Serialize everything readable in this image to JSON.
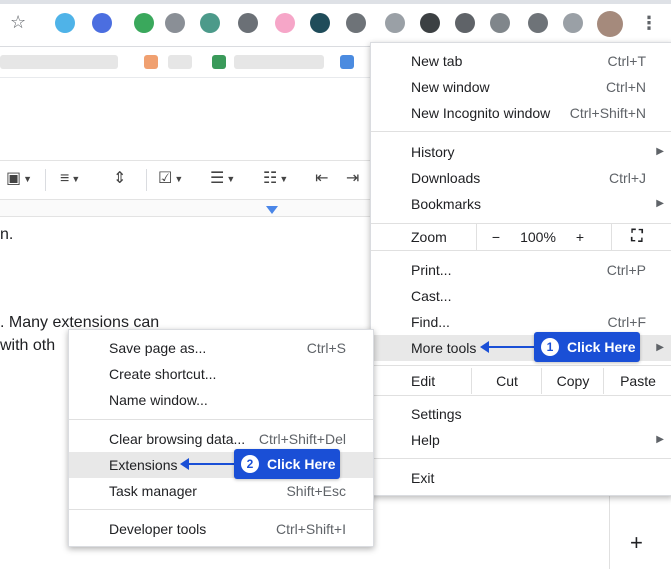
{
  "browser": {
    "star_icon": "star-icon",
    "more_icon": "vertical-dots-icon",
    "extension_colors": [
      "#4fb3e8",
      "#4b6ee0",
      "#3aa85c",
      "#8a8f96",
      "#4c9a8a",
      "#6b7076",
      "#f6a6c8",
      "#1f4c5a",
      "#6e7378",
      "#9aa0a6",
      "#3c4043",
      "#5f6368",
      "#80868b"
    ]
  },
  "doc": {
    "line1": "n.",
    "line2": ". Many extensions can",
    "line3": " with oth",
    "toolbar_icons": [
      "image-icon",
      "align-icon",
      "line-spacing-icon",
      "checklist-icon",
      "bullet-list-icon",
      "numbered-list-icon",
      "decrease-indent-icon",
      "increase-indent-icon"
    ],
    "plus_label": "+"
  },
  "menu": {
    "new_tab": {
      "label": "New tab",
      "shortcut": "Ctrl+T"
    },
    "new_window": {
      "label": "New window",
      "shortcut": "Ctrl+N"
    },
    "new_incognito": {
      "label": "New Incognito window",
      "shortcut": "Ctrl+Shift+N"
    },
    "history": {
      "label": "History"
    },
    "downloads": {
      "label": "Downloads",
      "shortcut": "Ctrl+J"
    },
    "bookmarks": {
      "label": "Bookmarks"
    },
    "zoom": {
      "label": "Zoom",
      "minus": "−",
      "value": "100%",
      "plus": "+"
    },
    "print": {
      "label": "Print...",
      "shortcut": "Ctrl+P"
    },
    "cast": {
      "label": "Cast..."
    },
    "find": {
      "label": "Find...",
      "shortcut": "Ctrl+F"
    },
    "more_tools": {
      "label": "More tools"
    },
    "edit": {
      "label": "Edit",
      "cut": "Cut",
      "copy": "Copy",
      "paste": "Paste"
    },
    "settings": {
      "label": "Settings"
    },
    "help": {
      "label": "Help"
    },
    "exit": {
      "label": "Exit"
    }
  },
  "submenu": {
    "save_page": {
      "label": "Save page as...",
      "shortcut": "Ctrl+S"
    },
    "create_shortcut": {
      "label": "Create shortcut..."
    },
    "name_window": {
      "label": "Name window..."
    },
    "clear_data": {
      "label": "Clear browsing data...",
      "shortcut": "Ctrl+Shift+Del"
    },
    "extensions": {
      "label": "Extensions"
    },
    "task_manager": {
      "label": "Task manager",
      "shortcut": "Shift+Esc"
    },
    "developer_tools": {
      "label": "Developer tools",
      "shortcut": "Ctrl+Shift+I"
    }
  },
  "callouts": {
    "one": {
      "num": "1",
      "text": "Click Here"
    },
    "two": {
      "num": "2",
      "text": "Click Here"
    },
    "color": "#1a4fd6"
  }
}
